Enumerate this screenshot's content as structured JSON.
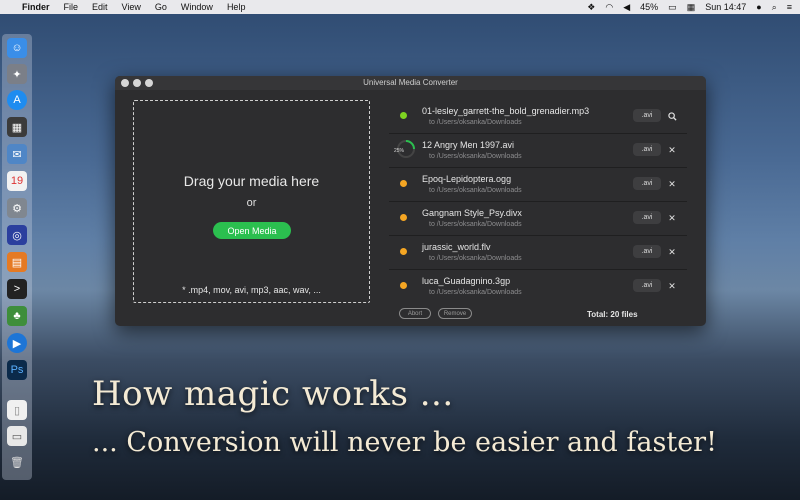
{
  "menubar": {
    "app": "Finder",
    "items": [
      "File",
      "Edit",
      "View",
      "Go",
      "Window",
      "Help"
    ],
    "battery": "45%",
    "clock": "Sun 14:47"
  },
  "window": {
    "title": "Universal Media Converter"
  },
  "dropzone": {
    "title": "Drag your media here",
    "or": "or",
    "button": "Open Media",
    "formats": "* .mp4, mov, avi, mp3, aac, wav, ..."
  },
  "files": [
    {
      "name": "01-lesley_garrett-the_bold_grenadier.mp3",
      "path": "to /Users/oksanka/Downloads",
      "format": ".avi",
      "status": "done",
      "action": "search"
    },
    {
      "name": "12 Angry Men 1997.avi",
      "path": "to /Users/oksanka/Downloads",
      "format": ".avi",
      "status": "progress",
      "progress": "25%",
      "action": "close"
    },
    {
      "name": "Epoq-Lepidoptera.ogg",
      "path": "to /Users/oksanka/Downloads",
      "format": ".avi",
      "status": "queued",
      "action": "close"
    },
    {
      "name": "Gangnam Style_Psy.divx",
      "path": "to /Users/oksanka/Downloads",
      "format": ".avi",
      "status": "queued",
      "action": "close"
    },
    {
      "name": "jurassic_world.flv",
      "path": "to /Users/oksanka/Downloads",
      "format": ".avi",
      "status": "queued",
      "action": "close"
    },
    {
      "name": "luca_Guadagnino.3gp",
      "path": "to /Users/oksanka/Downloads",
      "format": ".avi",
      "status": "queued",
      "action": "close"
    }
  ],
  "footer": {
    "abort": "Abort",
    "remove": "Remove",
    "total": "Total: 20 files"
  },
  "marketing": {
    "headline": "How magic works ...",
    "subline": "... Conversion will never be easier and faster!"
  },
  "colors": {
    "accent_green": "#2bbf4f",
    "done_dot": "#7ed321",
    "queued_dot": "#f5a623"
  }
}
